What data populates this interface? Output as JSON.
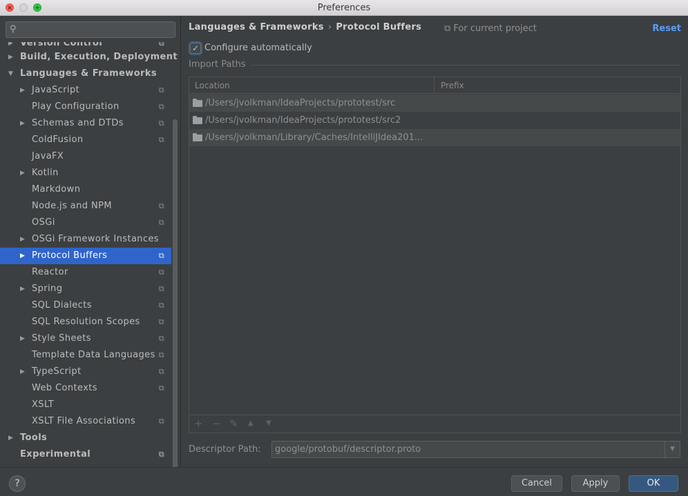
{
  "window": {
    "title": "Preferences"
  },
  "search": {
    "placeholder": "",
    "icon": "search-icon"
  },
  "sidebar": {
    "items": [
      {
        "label": "Version Control",
        "level": 0,
        "bold": true,
        "arrow": "▶",
        "project": true,
        "cut": true
      },
      {
        "label": "Build, Execution, Deployment",
        "level": 0,
        "bold": true,
        "arrow": "▶",
        "project": false
      },
      {
        "label": "Languages & Frameworks",
        "level": 0,
        "bold": true,
        "arrow": "▼",
        "project": false
      },
      {
        "label": "JavaScript",
        "level": 1,
        "arrow": "▶",
        "project": true
      },
      {
        "label": "Play Configuration",
        "level": 1,
        "arrow": "",
        "project": true
      },
      {
        "label": "Schemas and DTDs",
        "level": 1,
        "arrow": "▶",
        "project": true
      },
      {
        "label": "ColdFusion",
        "level": 1,
        "arrow": "",
        "project": true
      },
      {
        "label": "JavaFX",
        "level": 1,
        "arrow": "",
        "project": false
      },
      {
        "label": "Kotlin",
        "level": 1,
        "arrow": "▶",
        "project": false
      },
      {
        "label": "Markdown",
        "level": 1,
        "arrow": "",
        "project": false
      },
      {
        "label": "Node.js and NPM",
        "level": 1,
        "arrow": "",
        "project": true
      },
      {
        "label": "OSGi",
        "level": 1,
        "arrow": "",
        "project": true
      },
      {
        "label": "OSGi Framework Instances",
        "level": 1,
        "arrow": "▶",
        "project": false
      },
      {
        "label": "Protocol Buffers",
        "level": 1,
        "arrow": "▶",
        "project": true,
        "selected": true
      },
      {
        "label": "Reactor",
        "level": 1,
        "arrow": "",
        "project": true
      },
      {
        "label": "Spring",
        "level": 1,
        "arrow": "▶",
        "project": true
      },
      {
        "label": "SQL Dialects",
        "level": 1,
        "arrow": "",
        "project": true
      },
      {
        "label": "SQL Resolution Scopes",
        "level": 1,
        "arrow": "",
        "project": true
      },
      {
        "label": "Style Sheets",
        "level": 1,
        "arrow": "▶",
        "project": true
      },
      {
        "label": "Template Data Languages",
        "level": 1,
        "arrow": "",
        "project": true
      },
      {
        "label": "TypeScript",
        "level": 1,
        "arrow": "▶",
        "project": true
      },
      {
        "label": "Web Contexts",
        "level": 1,
        "arrow": "",
        "project": true
      },
      {
        "label": "XSLT",
        "level": 1,
        "arrow": "",
        "project": false
      },
      {
        "label": "XSLT File Associations",
        "level": 1,
        "arrow": "",
        "project": true
      },
      {
        "label": "Tools",
        "level": 0,
        "bold": true,
        "arrow": "▶",
        "project": false
      },
      {
        "label": "Experimental",
        "level": 0,
        "bold": true,
        "arrow": "",
        "project": true
      }
    ]
  },
  "main": {
    "breadcrumb": {
      "parent": "Languages & Frameworks",
      "sep": "›",
      "current": "Protocol Buffers"
    },
    "current_project": "⧉ For current project",
    "reset": "Reset",
    "configure": {
      "label": "Configure automatically",
      "checked": true,
      "mark": "✓"
    },
    "import_paths": {
      "title": "Import Paths",
      "columns": [
        "Location",
        "Prefix"
      ],
      "rows": [
        {
          "location": "/Users/jvolkman/IdeaProjects/prototest/src",
          "prefix": ""
        },
        {
          "location": "/Users/jvolkman/IdeaProjects/prototest/src2",
          "prefix": ""
        },
        {
          "location": "/Users/jvolkman/Library/Caches/IntelliJIdea201...",
          "prefix": ""
        }
      ],
      "toolbar": {
        "add": "+",
        "remove": "−",
        "edit": "✎",
        "up": "▲",
        "down": "▼"
      }
    },
    "descriptor": {
      "label": "Descriptor Path:",
      "value": "google/protobuf/descriptor.proto",
      "dropdown": "▼"
    }
  },
  "footer": {
    "help": "?",
    "cancel": "Cancel",
    "apply": "Apply",
    "ok": "OK"
  },
  "colors": {
    "selection": "#2f65ca",
    "link": "#589df6",
    "ok_button": "#365880",
    "background": "#3c3f41"
  }
}
